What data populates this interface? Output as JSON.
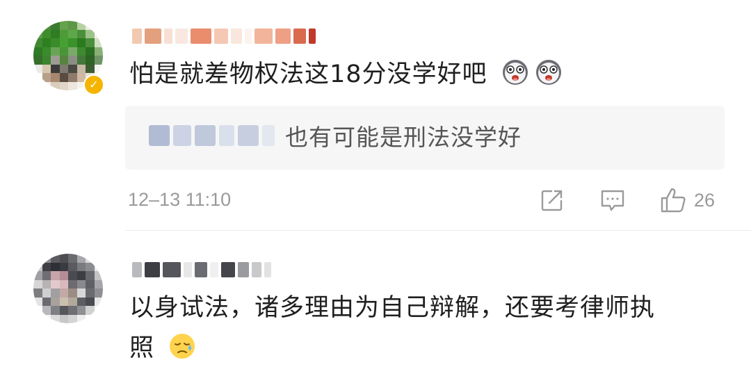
{
  "comments": [
    {
      "text": "怕是就差物权法这18分没学好吧",
      "verified_icon": "✓",
      "emojis": [
        "shocked-emoji",
        "shocked-emoji"
      ],
      "reply": {
        "text": "也有可能是刑法没学好"
      },
      "time": "12–13 11:10",
      "actions": {
        "share_icon": "share-icon",
        "comment_icon": "comment-icon",
        "like_icon": "thumbs-up-icon",
        "like_count": "26"
      }
    },
    {
      "text_line1": "以身试法，诸多理由为自己辩解，还要考律师执",
      "text_line2": "照",
      "emoji": "sweat-emoji"
    }
  ],
  "colors": {
    "meta_gray": "#9a9a9a",
    "reply_bg": "#f6f6f6",
    "verified": "#f5b400"
  }
}
